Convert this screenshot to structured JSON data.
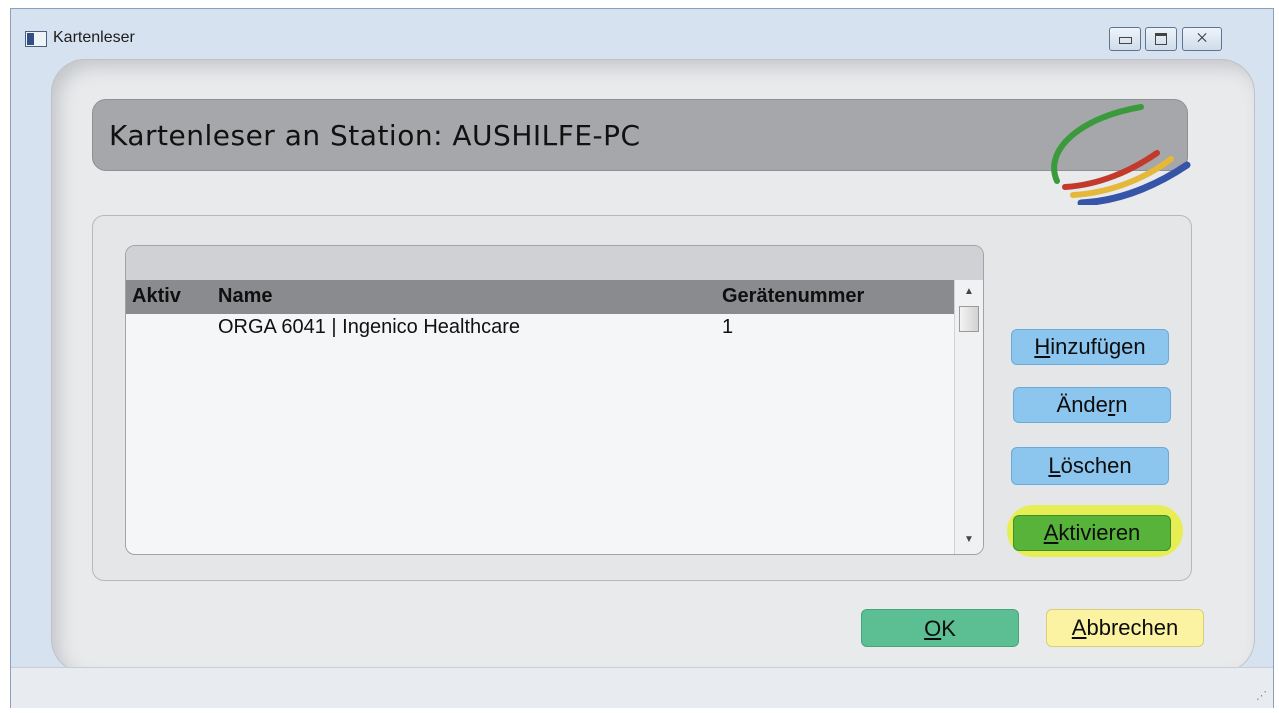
{
  "window": {
    "title": "Kartenleser",
    "minimize_icon": "minimize-icon",
    "maximize_icon": "maximize-icon",
    "close_icon": "close-icon",
    "close_glyph": "⨉"
  },
  "header": {
    "title": "Kartenleser an Station: AUSHILFE-PC",
    "logo_icon": "swoosh-logo-icon"
  },
  "table": {
    "columns": [
      "Aktiv",
      "Name",
      "Gerätenummer"
    ],
    "rows": [
      {
        "aktiv": "",
        "name": "ORGA 6041 | Ingenico Healthcare",
        "number": "1"
      }
    ]
  },
  "buttons": {
    "add": {
      "mnemonic": "H",
      "rest": "inzufügen"
    },
    "edit": {
      "before": "Ände",
      "mnemonic": "r",
      "after": "n"
    },
    "delete": {
      "mnemonic": "L",
      "rest": "öschen"
    },
    "activate": {
      "mnemonic": "A",
      "rest": "ktivieren"
    },
    "ok": {
      "mnemonic": "O",
      "rest": "K"
    },
    "cancel": {
      "mnemonic": "A",
      "rest": "bbrechen"
    }
  },
  "colors": {
    "header_bar": "#a6a7aa",
    "activate_highlight": "#e6ef3a",
    "ok": "#5bbf93",
    "cancel": "#fbf3a2",
    "secondary": "#8cc6ef"
  }
}
